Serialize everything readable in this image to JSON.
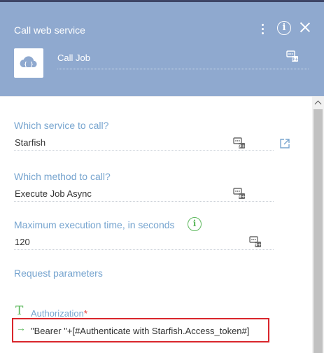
{
  "window": {
    "title": "Call web service"
  },
  "process": {
    "job_name": "Call Job"
  },
  "fields": {
    "service": {
      "label": "Which service to call?",
      "value": "Starfish"
    },
    "method": {
      "label": "Which method to call?",
      "value": "Execute Job Async"
    },
    "timeout": {
      "label": "Maximum execution time, in seconds",
      "value": "120"
    },
    "request_params_label": "Request parameters",
    "authorization": {
      "type_icon": "T",
      "label": "Authorization",
      "required_mark": "*",
      "value": "\"Bearer \"+[#Authenticate with Starfish.Access_token#]"
    }
  },
  "icons": {
    "header": [
      "more-vertical-icon",
      "info-icon",
      "close-icon"
    ],
    "tile": "cloud-api-icon",
    "field": [
      "parameter-icon",
      "external-link-icon",
      "info-icon",
      "arrow-right-icon",
      "text-type-icon"
    ]
  },
  "colors": {
    "header_bg": "#8fa9cf",
    "label": "#76a4cf",
    "accent_green": "#5cb85c",
    "highlight_box": "#d9262c"
  }
}
